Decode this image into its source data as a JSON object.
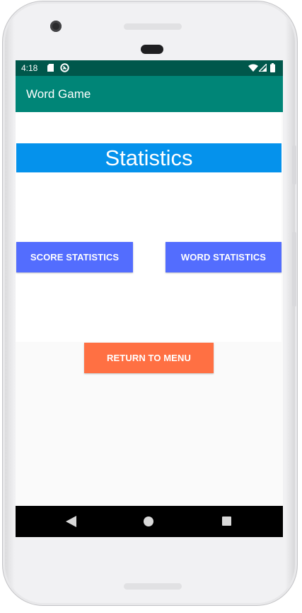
{
  "status_bar": {
    "time": "4:18",
    "left_icons": [
      "sd-card-icon",
      "sync-icon"
    ],
    "right_icons": [
      "wifi-icon",
      "cell-signal-icon",
      "battery-icon"
    ]
  },
  "app_bar": {
    "title": "Word Game",
    "color": "#008577"
  },
  "main": {
    "heading": "Statistics",
    "heading_color": "#0592ec",
    "score_button_label": "SCORE STATISTICS",
    "word_button_label": "WORD STATISTICS",
    "stats_button_color": "#536dfe",
    "return_button_label": "RETURN TO MENU",
    "return_button_color": "#ff7043"
  },
  "nav_bar": {
    "buttons": [
      "back-icon",
      "home-icon",
      "recent-apps-icon"
    ]
  }
}
